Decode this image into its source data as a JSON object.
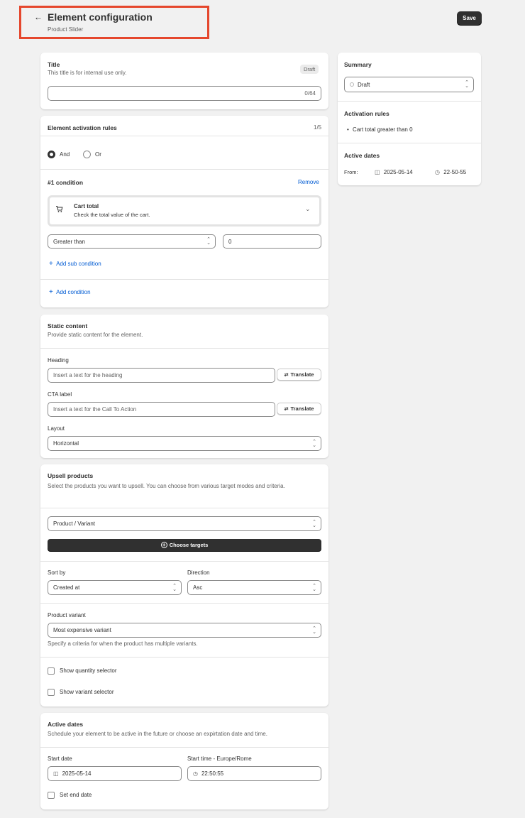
{
  "header": {
    "title": "Element configuration",
    "subtitle": "Product Slider",
    "save_label": "Save",
    "back_icon": "arrow-left-icon"
  },
  "title_card": {
    "label": "Title",
    "help": "This title is for internal use only.",
    "badge": "Draft",
    "value": "",
    "counter": "0/64"
  },
  "activation": {
    "label": "Element activation rules",
    "count": "1/5",
    "logic_options": [
      {
        "label": "And",
        "selected": true
      },
      {
        "label": "Or",
        "selected": false
      }
    ],
    "condition_title": "#1 condition",
    "remove_label": "Remove",
    "condition_name": "Cart total",
    "condition_desc": "Check the total value of the cart.",
    "operator": "Greater than",
    "value": "0",
    "add_sub_label": "Add sub condition",
    "add_condition_label": "Add condition"
  },
  "static_content": {
    "label": "Static content",
    "help": "Provide static content for the element.",
    "heading_label": "Heading",
    "heading_placeholder": "Insert a text for the heading",
    "cta_label": "CTA label",
    "cta_placeholder": "Insert a text for the Call To Action",
    "translate_label": "Translate",
    "layout_label": "Layout",
    "layout_value": "Horizontal"
  },
  "upsell": {
    "label": "Upsell products",
    "help": "Select the products you want to upsell. You can choose from various target modes and criteria.",
    "target_mode": "Product / Variant",
    "choose_label": "Choose targets",
    "sort_label": "Sort by",
    "sort_value": "Created at",
    "direction_label": "Direction",
    "direction_value": "Asc",
    "variant_label": "Product variant",
    "variant_value": "Most expensive variant",
    "variant_help": "Specify a criteria for when the product has multiple variants.",
    "qty_selector_label": "Show quantity selector",
    "variant_selector_label": "Show variant selector"
  },
  "active_dates": {
    "label": "Active dates",
    "help": "Schedule your element to be active in the future or choose an expirtation date and time.",
    "start_date_label": "Start date",
    "start_date": "2025-05-14",
    "start_time_label": "Start time - Europe/Rome",
    "start_time": "22:50:55",
    "end_date_label": "Set end date"
  },
  "summary": {
    "label": "Summary",
    "status": "Draft",
    "rules_label": "Activation rules",
    "rules": [
      "Cart total greater than 0"
    ],
    "dates_label": "Active dates",
    "from_label": "From:",
    "from_date": "2025-05-14",
    "from_time": "22-50-55"
  },
  "colors": {
    "accent": "#005bd3",
    "highlight_border": "#e5472d",
    "dark_button": "#303030"
  }
}
